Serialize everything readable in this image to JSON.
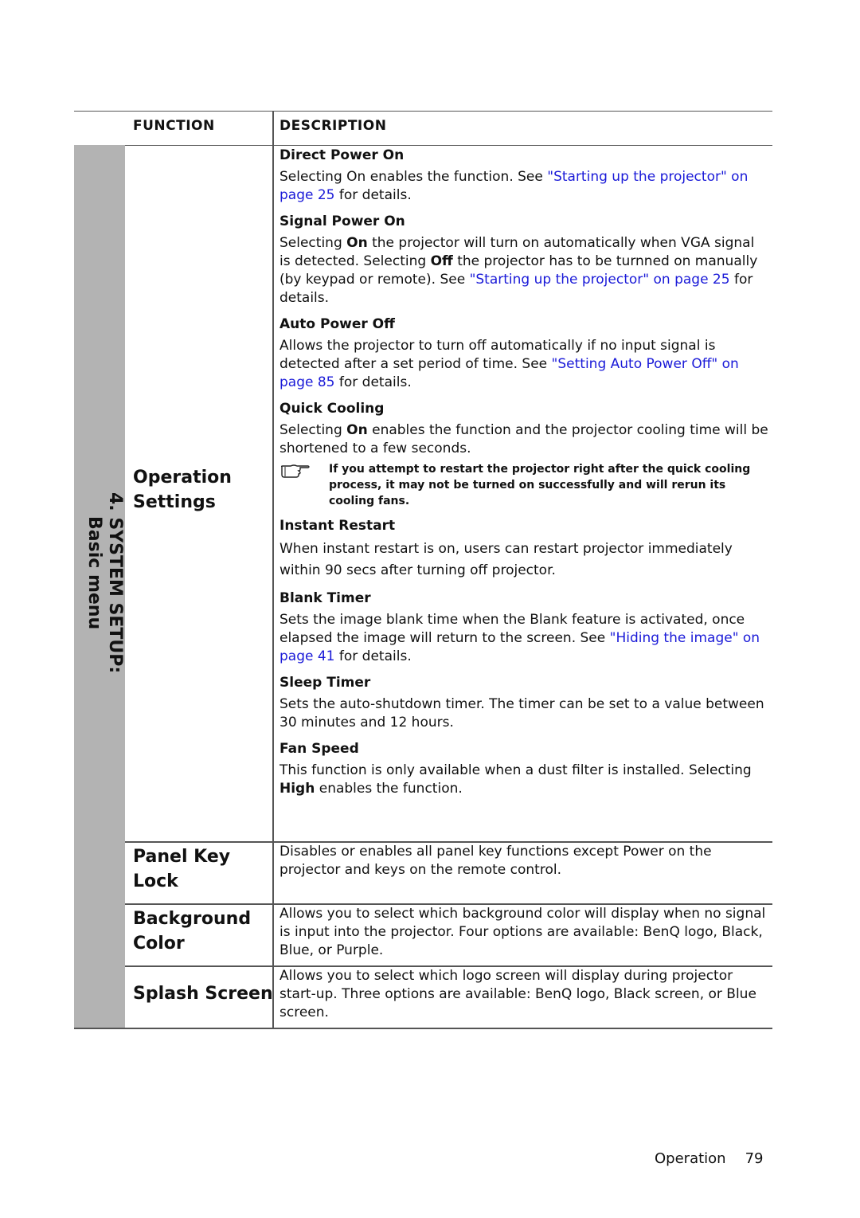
{
  "header": {
    "function": "FUNCTION",
    "description": "DESCRIPTION"
  },
  "section": {
    "line1": "4. SYSTEM SETUP:",
    "line2": "Basic menu"
  },
  "rows": [
    {
      "name_line1": "Operation",
      "name_line2": "Settings",
      "items": [
        {
          "title": "Direct Power On",
          "text_before": "Selecting On enables the function. See ",
          "link": "\"Starting up the projector\" on page 25",
          "text_after": " for details."
        },
        {
          "title": "Signal Power On",
          "text_before": "Selecting ",
          "bold1": "On",
          "text_mid1": " the projector will turn on automatically when VGA signal is detected. Selecting ",
          "bold2": "Off",
          "text_mid2": " the projector has to be turnned on manually (by keypad or remote). See ",
          "link": "\"Starting up the projector\" on page 25",
          "text_after": " for details."
        },
        {
          "title": "Auto Power Off",
          "text_before": "Allows the projector to turn off automatically if no input signal is detected after a set period of time. See ",
          "link": "\"Setting Auto Power Off\" on page 85",
          "text_after": " for details."
        },
        {
          "title": "Quick Cooling",
          "text_before": "Selecting ",
          "bold1": "On",
          "text_after": " enables the function and the projector cooling time will be shortened to a few seconds.",
          "note": "If you attempt to restart the projector right after the quick cooling process, it may not be turned on successfully and will rerun its cooling fans.",
          "note_icon": "pointing-hand-icon"
        },
        {
          "title": "Instant Restart",
          "text": "When instant restart is on, users can restart projector immediately within 90 secs after turning off projector."
        },
        {
          "title": "Blank Timer",
          "text_before": "Sets the image blank time when the Blank feature is activated, once elapsed the image will return to the screen. See ",
          "link": "\"Hiding the image\" on page 41",
          "text_after": "  for details."
        },
        {
          "title": "Sleep Timer",
          "text": "Sets the auto-shutdown timer. The timer can be set to a value between 30 minutes and 12 hours."
        },
        {
          "title": "Fan Speed",
          "text_before": "This function is only available when a dust filter is installed. Selecting ",
          "bold1": "High",
          "text_after": " enables the function."
        }
      ]
    },
    {
      "name_line1": "Panel Key",
      "name_line2": "Lock",
      "text": "Disables or enables all panel key functions except Power on the projector and keys on the remote control."
    },
    {
      "name_line1": "Background",
      "name_line2": "Color",
      "text": "Allows you to select which background color will display when no signal is input into the projector. Four options are available: BenQ logo, Black, Blue, or Purple."
    },
    {
      "name_line1": "Splash Screen",
      "text": "Allows you to select which logo screen will display during projector start-up. Three options are available: BenQ logo, Black screen, or Blue screen."
    }
  ],
  "footer": {
    "section": "Operation",
    "page": "79"
  }
}
